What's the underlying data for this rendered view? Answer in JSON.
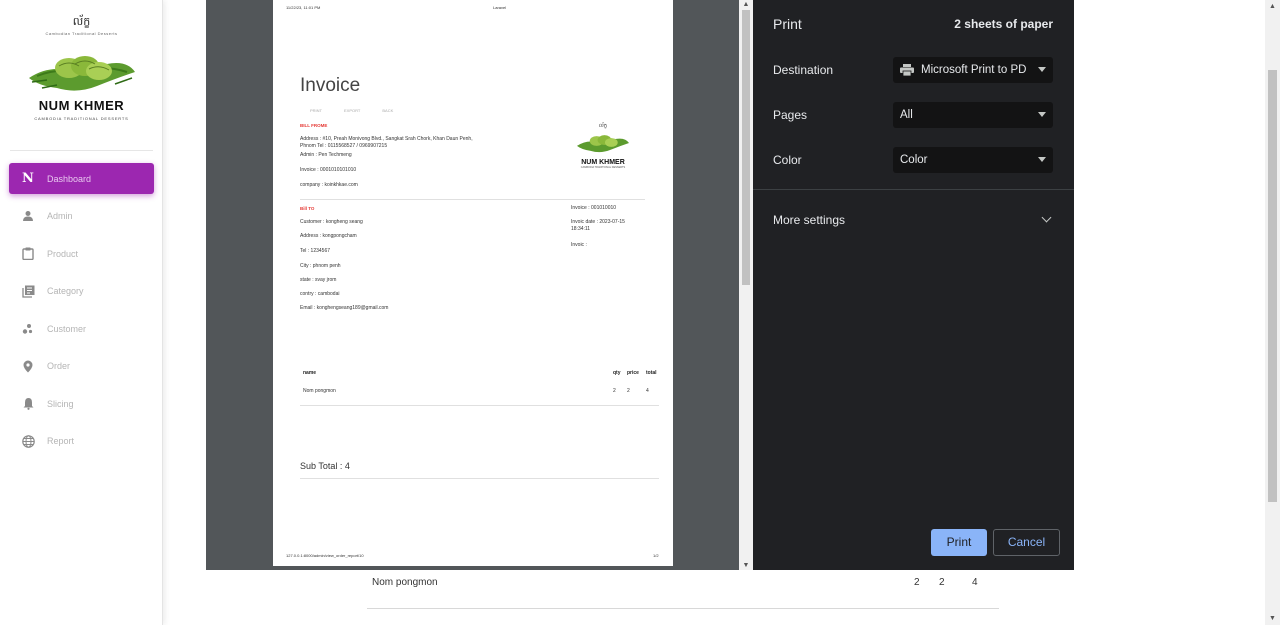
{
  "sidebar": {
    "brand": {
      "khmer": "ល័ក្ខ",
      "khmer_sub": "Cambodian Traditional Desserts",
      "name": "NUM KHMER",
      "tagline": "CAMBODIA TRADITIONAL DESSERTS"
    },
    "items": [
      {
        "label": "Dashboard",
        "icon": "N-letter-icon",
        "active": true
      },
      {
        "label": "Admin",
        "icon": "person-icon"
      },
      {
        "label": "Product",
        "icon": "clipboard-icon"
      },
      {
        "label": "Category",
        "icon": "library-icon"
      },
      {
        "label": "Customer",
        "icon": "bubbles-icon"
      },
      {
        "label": "Order",
        "icon": "location-pin-icon"
      },
      {
        "label": "Slicing",
        "icon": "bell-icon"
      },
      {
        "label": "Report",
        "icon": "globe-icon"
      }
    ]
  },
  "background": {
    "row_name": "Nom pongmon",
    "qty": "2",
    "price": "2",
    "total": "4"
  },
  "print_dialog": {
    "title": "Print",
    "sheets": "2 sheets of paper",
    "destination_label": "Destination",
    "destination_value": "Microsoft Print to PD",
    "pages_label": "Pages",
    "pages_value": "All",
    "color_label": "Color",
    "color_value": "Color",
    "more_settings": "More settings",
    "print_button": "Print",
    "cancel_button": "Cancel",
    "colors": {
      "accent": "#8ab4f8",
      "panel": "#202124",
      "preview_bg": "#525659"
    }
  },
  "preview": {
    "header_left": "11/22/23, 11:01 PM",
    "header_center": "Laravel",
    "title": "Invoice",
    "actions": [
      "PRINT",
      "EXPORT",
      "BACK"
    ],
    "bill_from_label": "BILL FROME",
    "bill_from_address": "Address : #10, Preah Monivong Blvd., Sangkat Srah Chork, Khan Daun Penh, Phnom Tel : 0115568527 / 0969907215",
    "bill_from_admin": "Admin : Pen Techmeng",
    "bill_from_invoice": "Invoice : 0001010101010",
    "bill_from_company": "company : koinkhkae.com",
    "logo_khmer": "ល័ក្ខ",
    "logo_name": "NUM KHMER",
    "logo_tag": "CAMBODIA TRADITIONAL DESSERTS",
    "bill_to_label": "Bill TO",
    "customer": "Customer : kongheng seang",
    "address": "Address : kongpongcham",
    "tel": "Tel : 1234567",
    "city": "City : phnom penh",
    "state": "state : svay jrom",
    "country": "contry : cambodai",
    "email": "Email : konghengseang189@gmail.com",
    "invoice_no": "Invoice : 001010010",
    "invoice_date": "Invoic date : 2023-07-15 18:34:11",
    "invoice_extra": "Invoic :",
    "table_headers": {
      "name": "name",
      "qty": "qty",
      "price": "price",
      "total": "total"
    },
    "table_rows": [
      {
        "name": "Nom pongmon",
        "qty": "2",
        "price": "2",
        "total": "4"
      }
    ],
    "subtotal": "Sub Total : 4",
    "footer_left": "127.0.0.1:8000/admin/view_order_report/10",
    "footer_right": "1/2"
  }
}
